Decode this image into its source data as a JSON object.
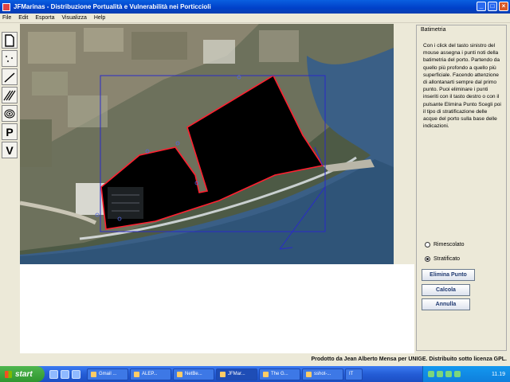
{
  "window": {
    "title": "JFMarinas - Distribuzione Portualità e Vulnerabilità nei Porticcioli",
    "controls": [
      "_",
      "□",
      "×"
    ]
  },
  "menu": [
    "File",
    "Edit",
    "Esporta",
    "Visualizza",
    "Help"
  ],
  "tools": [
    {
      "icon": "page-icon",
      "glyph": ""
    },
    {
      "icon": "points-icon",
      "glyph": ""
    },
    {
      "icon": "line-icon",
      "glyph": ""
    },
    {
      "icon": "hatch-icon",
      "glyph": ""
    },
    {
      "icon": "contour-icon",
      "glyph": ""
    },
    {
      "icon": "letter-p-icon",
      "glyph": "P"
    },
    {
      "icon": "letter-v-icon",
      "glyph": "V"
    }
  ],
  "panel": {
    "title": "Batimetria",
    "text": "Con i click del tasto sinistro del mouse assegna i punti noti della batimetria del porto. Partendo da quello più profondo a quello più superficiale. Facendo attenzione di allontanarti sempre dal primo punto. Puoi eliminare i punti inseriti con il tasto destro o con il pulsante Elimina Punto Scegli poi il tipo di stratificazione delle acque del porto sulla base delle indicazioni.",
    "radio_rimescolato": "Rimescolato",
    "radio_stratificato": "Stratificato",
    "selected": "Stratificato",
    "btn_elimina": "Elimina Punto",
    "btn_calcola": "Calcola",
    "btn_annulla": "Annulla"
  },
  "footer": "Prodotto da Jean Alberto Mensa per UNIGE. Distribuito sotto licenza GPL.",
  "taskbar": {
    "start": "start",
    "tasks": [
      "Gmail ...",
      "ALEP...",
      "NetBe...",
      "JFMar...",
      "The G...",
      "sshot-...",
      "IT"
    ],
    "active_task": "JFMar...",
    "clock": "11.19"
  },
  "colors": {
    "polygon_fill": "#000000",
    "polygon_outline": "#ff2030",
    "selection_box": "#2a2ac8",
    "accent": "#245dd6"
  }
}
